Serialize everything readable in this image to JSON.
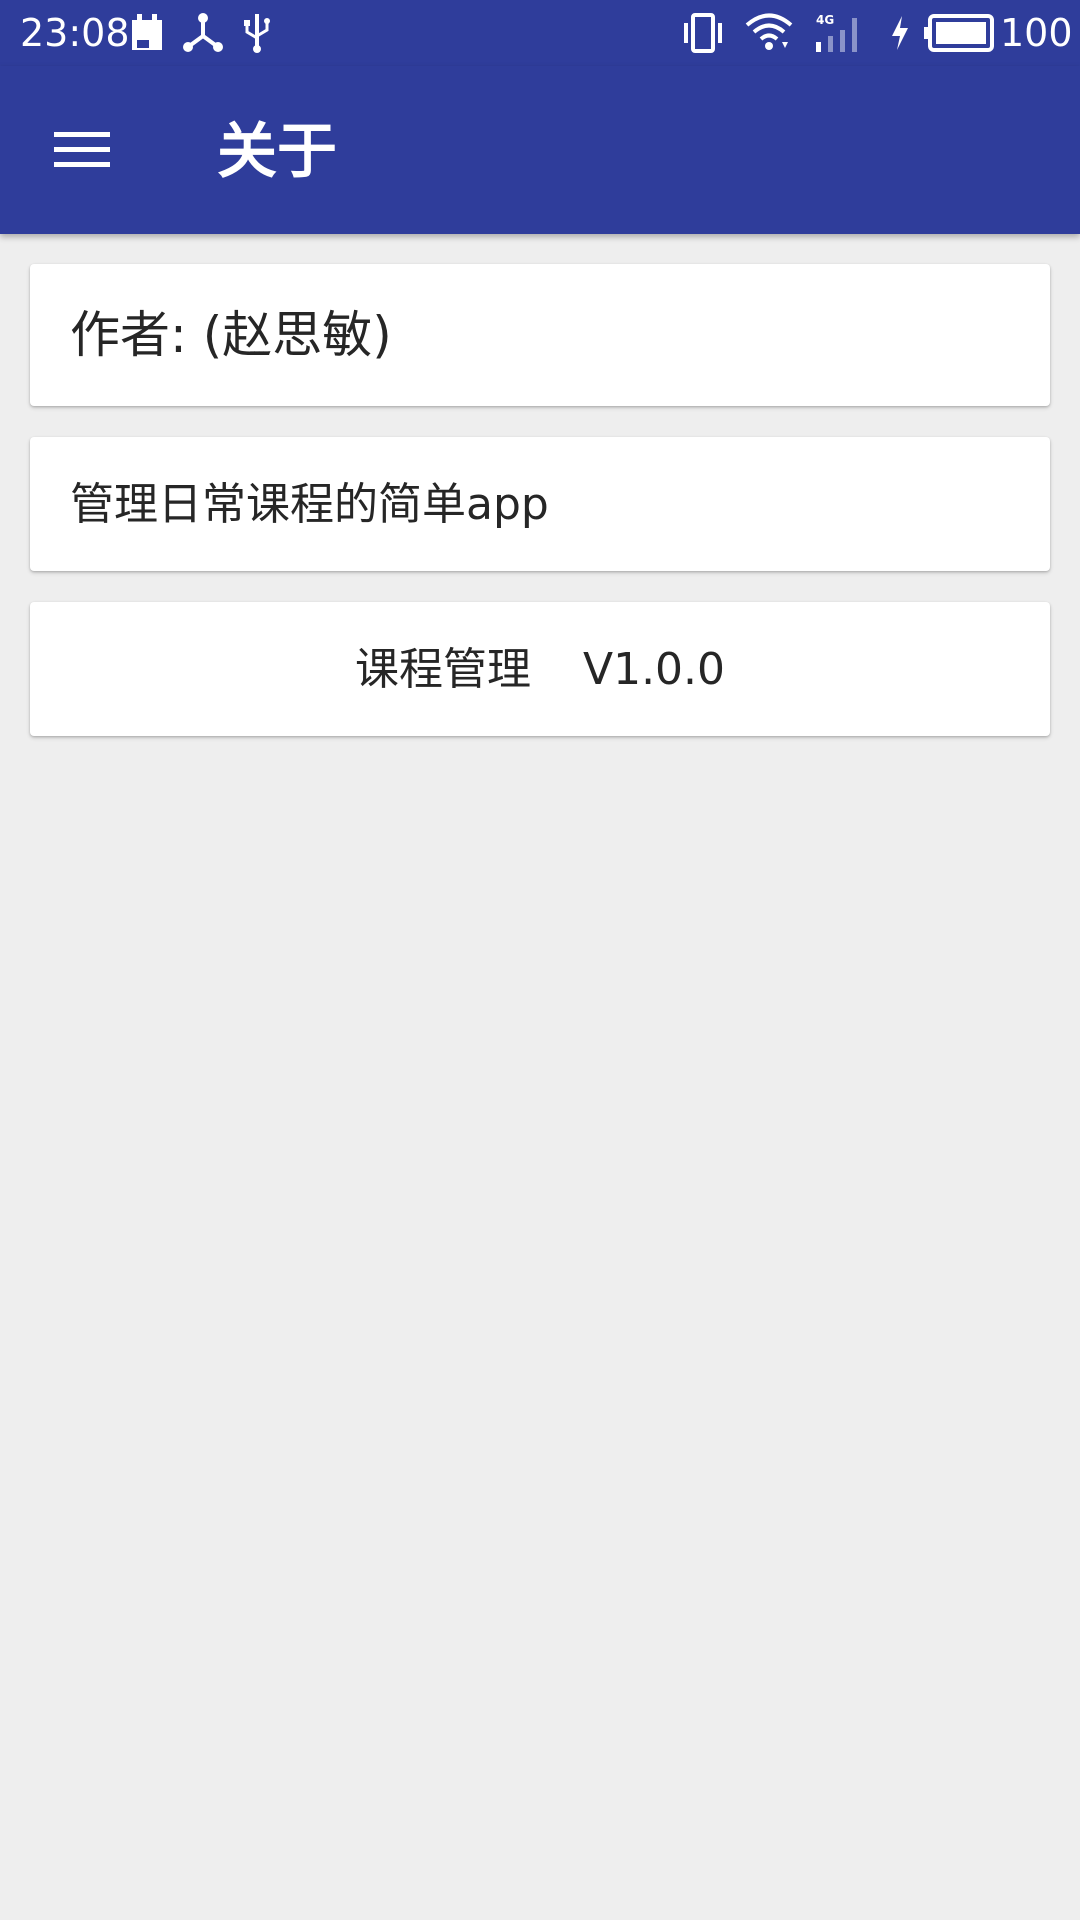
{
  "status_bar": {
    "time": "23:08",
    "battery_percent": "100",
    "icons": [
      "calendar-icon",
      "share-nodes-icon",
      "usb-icon",
      "vibrate-icon",
      "wifi-icon",
      "signal-4g-icon",
      "charging-icon",
      "battery-icon"
    ],
    "network_label": "4G"
  },
  "app_bar": {
    "title": "关于",
    "menu_icon": "hamburger-menu-icon"
  },
  "cards": {
    "author": "作者: (赵思敏)",
    "description": "管理日常课程的简单app",
    "app_name": "课程管理",
    "version": "V1.0.0"
  },
  "colors": {
    "primary": "#2f3d9b",
    "background": "#eeeeee",
    "card": "#ffffff",
    "text": "#262626"
  }
}
